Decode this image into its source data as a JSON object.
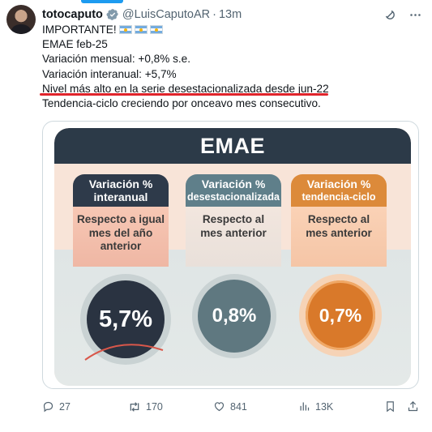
{
  "tweet": {
    "author_name": "totocaputo",
    "handle": "@LuisCaputoAR",
    "separator": "·",
    "time": "13m",
    "lines": [
      "IMPORTANTE!",
      "EMAE feb-25",
      "Variación mensual: +0,8% s.e.",
      "Variación interanual: +5,7%",
      "Nivel más alto en la serie desestacionalizada desde jun-22",
      "Tendencia-ciclo creciendo por onceavo mes consecutivo."
    ]
  },
  "infographic": {
    "title": "EMAE",
    "columns": [
      {
        "head_line1": "Variación %",
        "head_line2": "interanual",
        "sub_line1": "Respecto a igual",
        "sub_line2": "mes del año",
        "sub_line3": "anterior",
        "value": "5,7%"
      },
      {
        "head_line1": "Variación %",
        "head_line2": "desestacionalizada",
        "sub_line1": "Respecto al",
        "sub_line2": "mes anterior",
        "value": "0,8%"
      },
      {
        "head_line1": "Variación %",
        "head_line2": "tendencia-ciclo",
        "sub_line1": "Respecto al",
        "sub_line2": "mes anterior",
        "value": "0,7%"
      }
    ]
  },
  "actions": {
    "replies": "27",
    "reposts": "170",
    "likes": "841",
    "views": "13K"
  },
  "colors": {
    "accent": "#1d9bf0",
    "highlight_underline": "#e0242b",
    "col1": "#2e3a4a",
    "col2": "#5f7f8a",
    "col3": "#dc8a3a"
  },
  "icons": [
    "verified-badge-icon",
    "argentina-flag-icon",
    "grok-icon",
    "more-icon",
    "reply-icon",
    "repost-icon",
    "like-icon",
    "views-icon",
    "bookmark-icon",
    "share-icon"
  ]
}
